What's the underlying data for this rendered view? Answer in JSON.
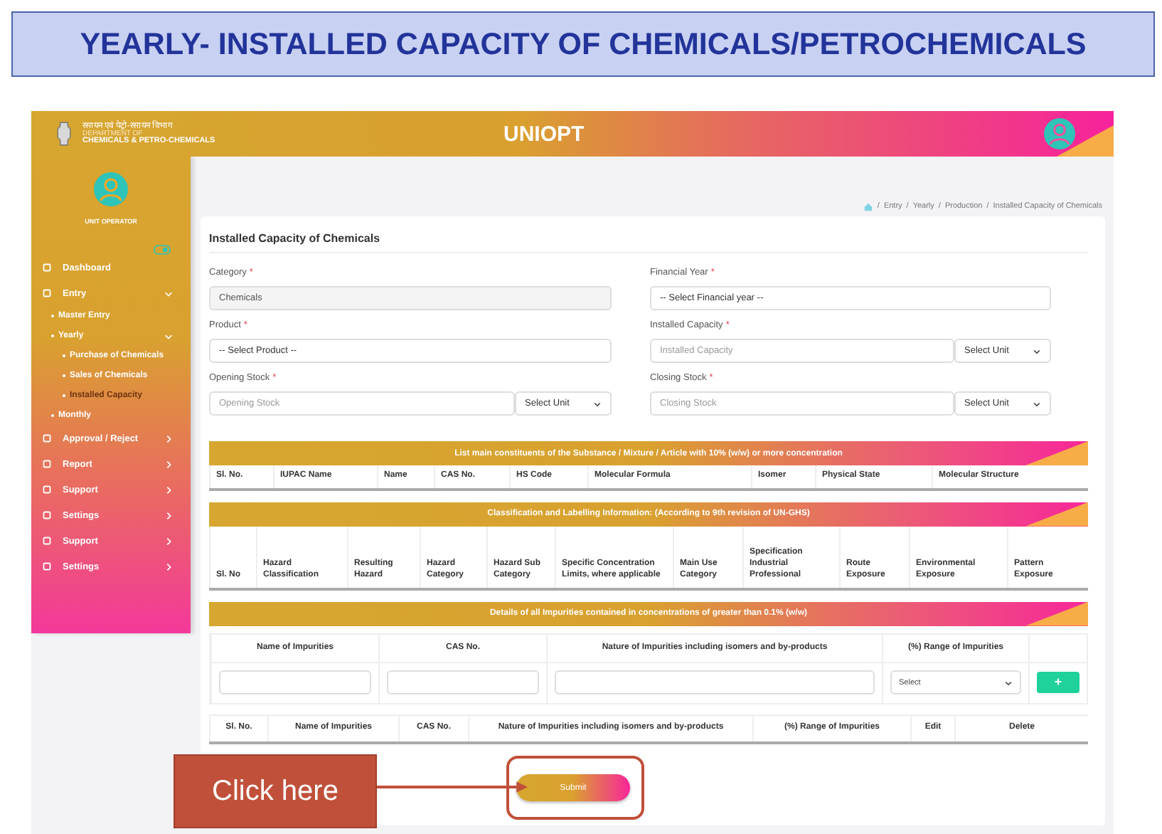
{
  "slide_title": "YEARLY- INSTALLED CAPACITY OF CHEMICALS/PETROCHEMICALS",
  "header": {
    "dept_hindi": "रसायन एवं पेट्रो-रसायन विभाग",
    "dept_line1": "DEPARTMENT OF",
    "dept_line2": "CHEMICALS & PETRO-CHEMICALS",
    "app_name": "UNIOPT"
  },
  "sidebar": {
    "user_role": "UNIT OPERATOR",
    "items": [
      {
        "label": "Dashboard",
        "selected": false
      },
      {
        "label": "Entry",
        "selected": false,
        "expanded": true,
        "children": [
          {
            "label": "Master Entry",
            "selected": false
          },
          {
            "label": "Yearly",
            "selected": false,
            "expanded": true,
            "children": [
              {
                "label": "Purchase of Chemicals",
                "selected": false
              },
              {
                "label": "Sales of Chemicals",
                "selected": false
              },
              {
                "label": "Installed Capacity",
                "selected": true
              }
            ]
          },
          {
            "label": "Monthly",
            "selected": false
          }
        ]
      },
      {
        "label": "Approval / Reject",
        "selected": false,
        "expanded": false
      },
      {
        "label": "Report",
        "selected": false,
        "expanded": false
      },
      {
        "label": "Support",
        "selected": false,
        "expanded": false
      },
      {
        "label": "Settings",
        "selected": false,
        "expanded": false
      },
      {
        "label": "Support",
        "selected": false,
        "expanded": false
      },
      {
        "label": "Settings",
        "selected": false,
        "expanded": false
      }
    ]
  },
  "breadcrumb": {
    "separator": "/",
    "items": [
      "Entry",
      "Yearly",
      "Production",
      "Installed Capacity of Chemicals"
    ]
  },
  "form": {
    "title": "Installed Capacity of Chemicals",
    "fields": [
      {
        "label": "Category",
        "required_mark": "*",
        "kind": "readonly",
        "value": "Chemicals"
      },
      {
        "label": "Financial Year",
        "required_mark": "*",
        "kind": "select",
        "value": "-- Select Financial year --"
      },
      {
        "label": "Product",
        "required_mark": "*",
        "kind": "select",
        "value": "-- Select Product --"
      },
      {
        "label": "Installed Capacity",
        "required_mark": "*",
        "kind": "unit",
        "placeholder": "Installed Capacity",
        "unit": "Select Unit"
      },
      {
        "label": "Opening Stock",
        "required_mark": "*",
        "kind": "unit",
        "placeholder": "Opening Stock",
        "unit": "Select Unit"
      },
      {
        "label": "Closing Stock",
        "required_mark": "*",
        "kind": "unit",
        "placeholder": "Closing Stock",
        "unit": "Select Unit"
      }
    ]
  },
  "constituents_table": {
    "title": "List main constituents of the Substance / Mixture / Article with 10% (w/w) or more concentration",
    "columns": [
      "Sl. No.",
      "IUPAC Name",
      "Name",
      "CAS No.",
      "HS Code",
      "Molecular Formula",
      "Isomer",
      "Physical State",
      "Molecular Structure"
    ]
  },
  "classification_table": {
    "title": "Classification and Labelling Information: (According to 9th revision of UN-GHS)",
    "columns": [
      "Sl. No",
      "Hazard Classification",
      "Resulting Hazard",
      "Hazard Category",
      "Hazard Sub Category",
      "Specific Concentration Limits, where applicable",
      "Main Use Category",
      "Specification Industrial Professional",
      "Route Exposure",
      "Environmental Exposure",
      "Pattern Exposure"
    ]
  },
  "impurities": {
    "title": "Details of all Impurities contained in concentrations of greater than 0.1% (w/w)",
    "entry_columns": [
      "Name of Impurities",
      "CAS No.",
      "Nature of Impurities including isomers and by-products",
      "(%) Range of Impurities"
    ],
    "range_select": "Select",
    "add_button": "+",
    "list_columns": [
      "Sl. No.",
      "Name of Impurities",
      "CAS No.",
      "Nature of Impurities including isomers and by-products",
      "(%) Range of Impurities",
      "Edit",
      "Delete"
    ]
  },
  "submit_button": "Submit",
  "callout": "Click here"
}
